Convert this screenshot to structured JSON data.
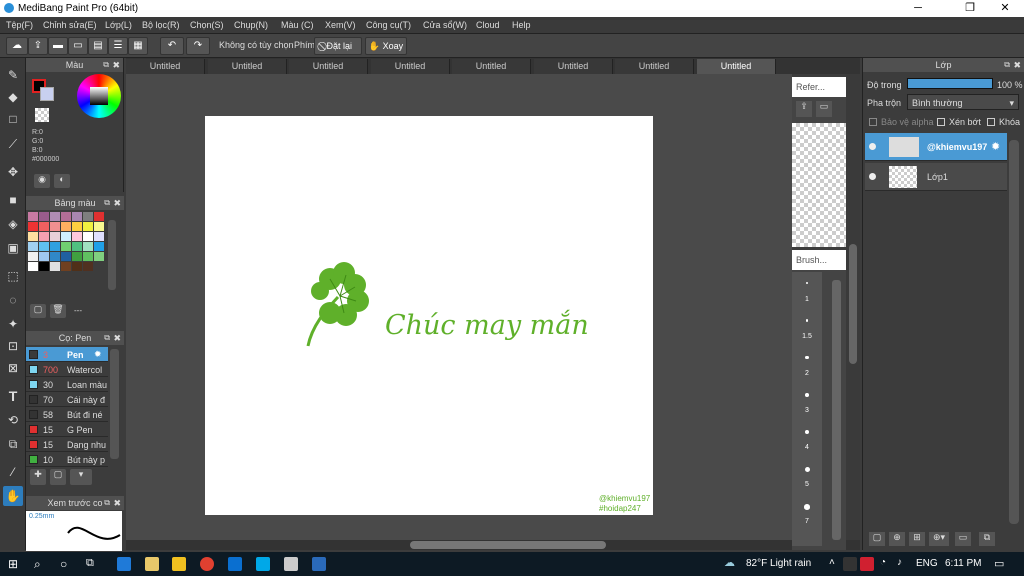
{
  "app": {
    "title": "MediBang Paint Pro (64bit)",
    "min": "─",
    "max": "❐",
    "close": "✕"
  },
  "menu": [
    "Tệp(F)",
    "Chỉnh sửa(E)",
    "Lớp(L)",
    "Bộ lọc(R)",
    "Chọn(S)",
    "Chụp(N)",
    "Màu (C)",
    "Xem(V)",
    "Công cụ(T)",
    "Cửa sổ(W)",
    "Cloud",
    "Help"
  ],
  "toolbar": {
    "no_option": "Không có tùy chọn",
    "key_label": "Phím",
    "reset": "Đặt lại",
    "rotate": "Xoay"
  },
  "color_panel": {
    "title": "Màu",
    "r": "R:0",
    "g": "G:0",
    "b": "B:0",
    "hex": "#000000"
  },
  "palette_panel": {
    "title": "Bảng màu",
    "dash": "---",
    "colors": [
      "#c87aa3",
      "#9a5c8c",
      "#b08cb4",
      "#b46e96",
      "#a886b0",
      "#7e7e7e",
      "#e03030",
      "#ee3333",
      "#f06060",
      "#f09090",
      "#ffb060",
      "#ffd040",
      "#f0f040",
      "#f8f890",
      "#ffe0a0",
      "#f4a0b0",
      "#e8d0d8",
      "#d0f0ff",
      "#ffc8dc",
      "#ffffff",
      "#e0e0ff",
      "#a0d0f0",
      "#60c0f0",
      "#30a0e0",
      "#70d070",
      "#50c080",
      "#a0e0c0",
      "#20a0e8",
      "#f0f0f0",
      "#a0c8f0",
      "#3088c8",
      "#2060a0",
      "#40a040",
      "#60c060",
      "#80d080",
      "#ffffff",
      "#000000",
      "#e0e0e0",
      "#704020",
      "#503018",
      "#503020"
    ]
  },
  "brush_panel": {
    "title": "Cọ: Pen",
    "items": [
      {
        "size": "3",
        "name": "Pen",
        "color": "#3a3a3a"
      },
      {
        "size": "700",
        "name": "Watercol",
        "color": "#7ed6f0"
      },
      {
        "size": "30",
        "name": "Loan màu",
        "color": "#7ed6f0"
      },
      {
        "size": "70",
        "name": "Cái này đ",
        "color": "#333"
      },
      {
        "size": "58",
        "name": "Bút đi né",
        "color": "#333"
      },
      {
        "size": "15",
        "name": "G Pen",
        "color": "#e03030"
      },
      {
        "size": "15",
        "name": "Dạng nhu",
        "color": "#e03030"
      },
      {
        "size": "10",
        "name": "Bút này p",
        "color": "#40b040"
      }
    ]
  },
  "preview_panel": {
    "title": "Xem trước co",
    "size": "0.25mm"
  },
  "tabs": [
    "Untitled",
    "Untitled",
    "Untitled",
    "Untitled",
    "Untitled",
    "Untitled",
    "Untitled",
    "Untitled"
  ],
  "canvas": {
    "text": "Chúc may mắn",
    "watermark1": "@khiemvu197",
    "watermark2": "#hoidap247"
  },
  "reference": {
    "title": "Refer..."
  },
  "brush_size_panel": {
    "title": "Brush...",
    "sizes": [
      "1",
      "1.5",
      "2",
      "3",
      "4",
      "5",
      "7"
    ]
  },
  "layer_panel": {
    "title": "Lớp",
    "opacity_label": "Độ trong",
    "opacity_value": "100 %",
    "opacity": 1.0,
    "blend_label": "Pha trộn",
    "blend_value": "Bình thường",
    "protect_alpha": "Bảo vệ alpha",
    "clip": "Xén bớt",
    "lock": "Khóa",
    "layers": [
      {
        "name": "@khiemvu197"
      },
      {
        "name": "Lớp1"
      }
    ]
  },
  "taskbar": {
    "weather": "82°F  Light rain",
    "lang": "ENG",
    "time": "6:11 PM"
  },
  "colors": {
    "accent": "#2d7dbd",
    "green": "#5fb02a",
    "layer_selected": "#4a9ad4"
  }
}
